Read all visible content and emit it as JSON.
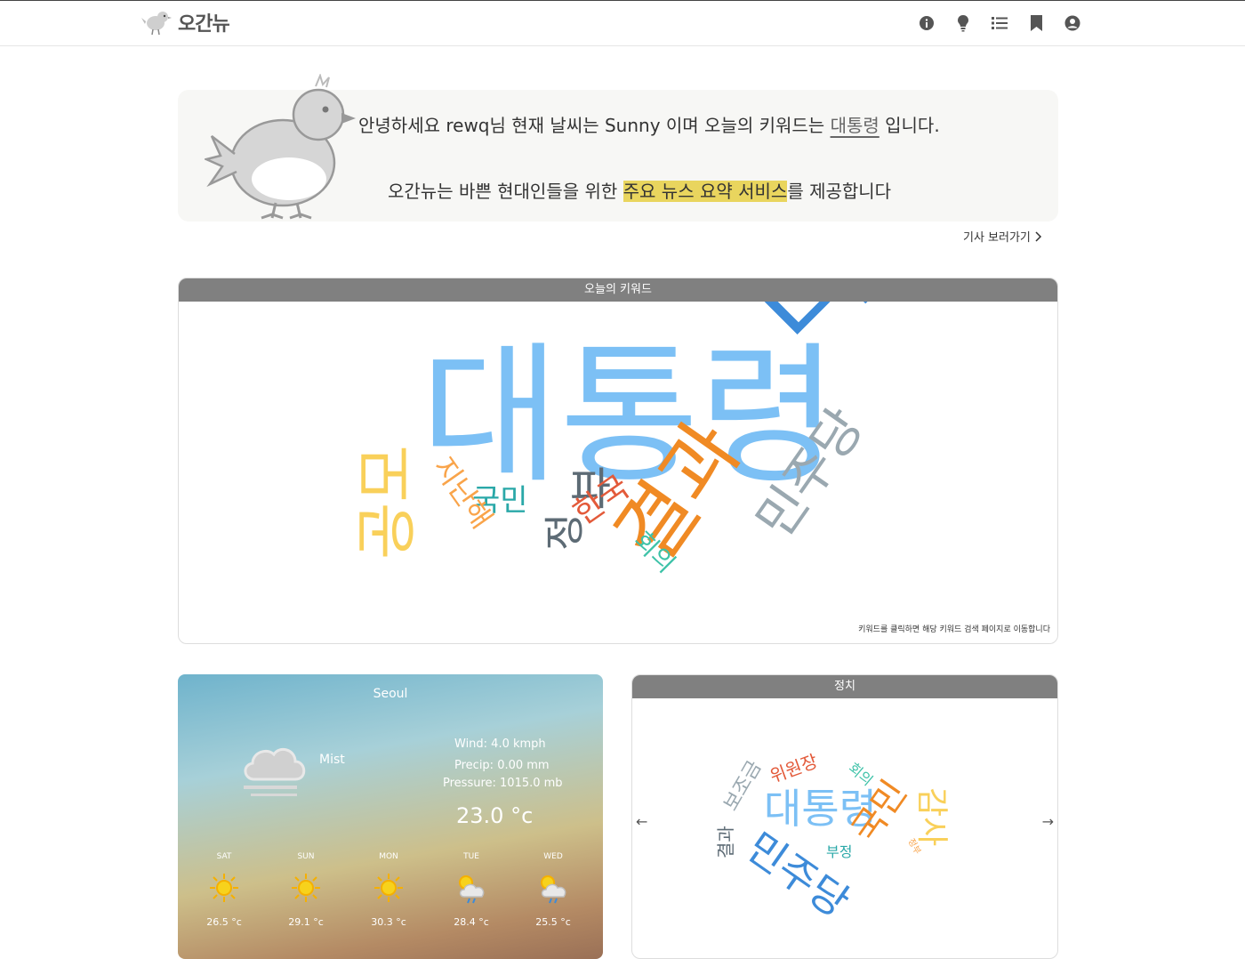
{
  "header": {
    "logo_text": "오간뉴",
    "icons": [
      "info-icon",
      "lightbulb-icon",
      "list-icon",
      "bookmark-icon",
      "account-icon"
    ]
  },
  "greeting": {
    "line1_prefix": "안녕하세요 rewq님 현재 날씨는 Sunny 이며 오늘의 키워드는",
    "keyword": "대통령",
    "line1_suffix": "입니다.",
    "line2_prefix": "오간뉴는 바쁜 현대인들을 위한",
    "line2_highlight": "주요 뉴스 요약 서비스",
    "line2_suffix": "를 제공합니다",
    "goto_label": "기사 보러가기"
  },
  "keyword_cloud": {
    "title": "오늘의 키워드",
    "hint": "키워드를 클릭하면 해당 키워드 검색 페이지로 이동합니다",
    "words": [
      "대통령",
      "미국",
      "국회",
      "결과",
      "민주당",
      "공모",
      "정부",
      "한국",
      "국민",
      "지난해",
      "회의"
    ],
    "colors": {
      "blue_light": "#7cc0f5",
      "blue_dark": "#3d8bd9",
      "orange": "#f08a24",
      "yellow": "#f9d05a",
      "gray": "#9aa8b0",
      "slate": "#5d6b75",
      "teal": "#2aa8a8",
      "red": "#e35a3a",
      "green": "#3ec2a8"
    }
  },
  "weather": {
    "city": "Seoul",
    "condition": "Mist",
    "wind": "Wind: 4.0 kmph",
    "precip": "Precip: 0.00 mm",
    "pressure": "Pressure: 1015.0 mb",
    "temp": "23.0 °c",
    "forecast": [
      {
        "day": "SAT",
        "temp": "26.5 °c",
        "icon": "sun-icon"
      },
      {
        "day": "SUN",
        "temp": "29.1 °c",
        "icon": "sun-icon"
      },
      {
        "day": "MON",
        "temp": "30.3 °c",
        "icon": "sun-icon"
      },
      {
        "day": "TUE",
        "temp": "28.4 °c",
        "icon": "sun-rain-cloud-icon"
      },
      {
        "day": "WED",
        "temp": "25.5 °c",
        "icon": "sun-rain-cloud-icon"
      }
    ]
  },
  "politics": {
    "title": "정치",
    "prev": "←",
    "next": "→",
    "words": [
      "대통령",
      "민주당",
      "국민",
      "감사",
      "위원장",
      "보조금",
      "결과",
      "회의",
      "부정",
      "정부"
    ]
  }
}
